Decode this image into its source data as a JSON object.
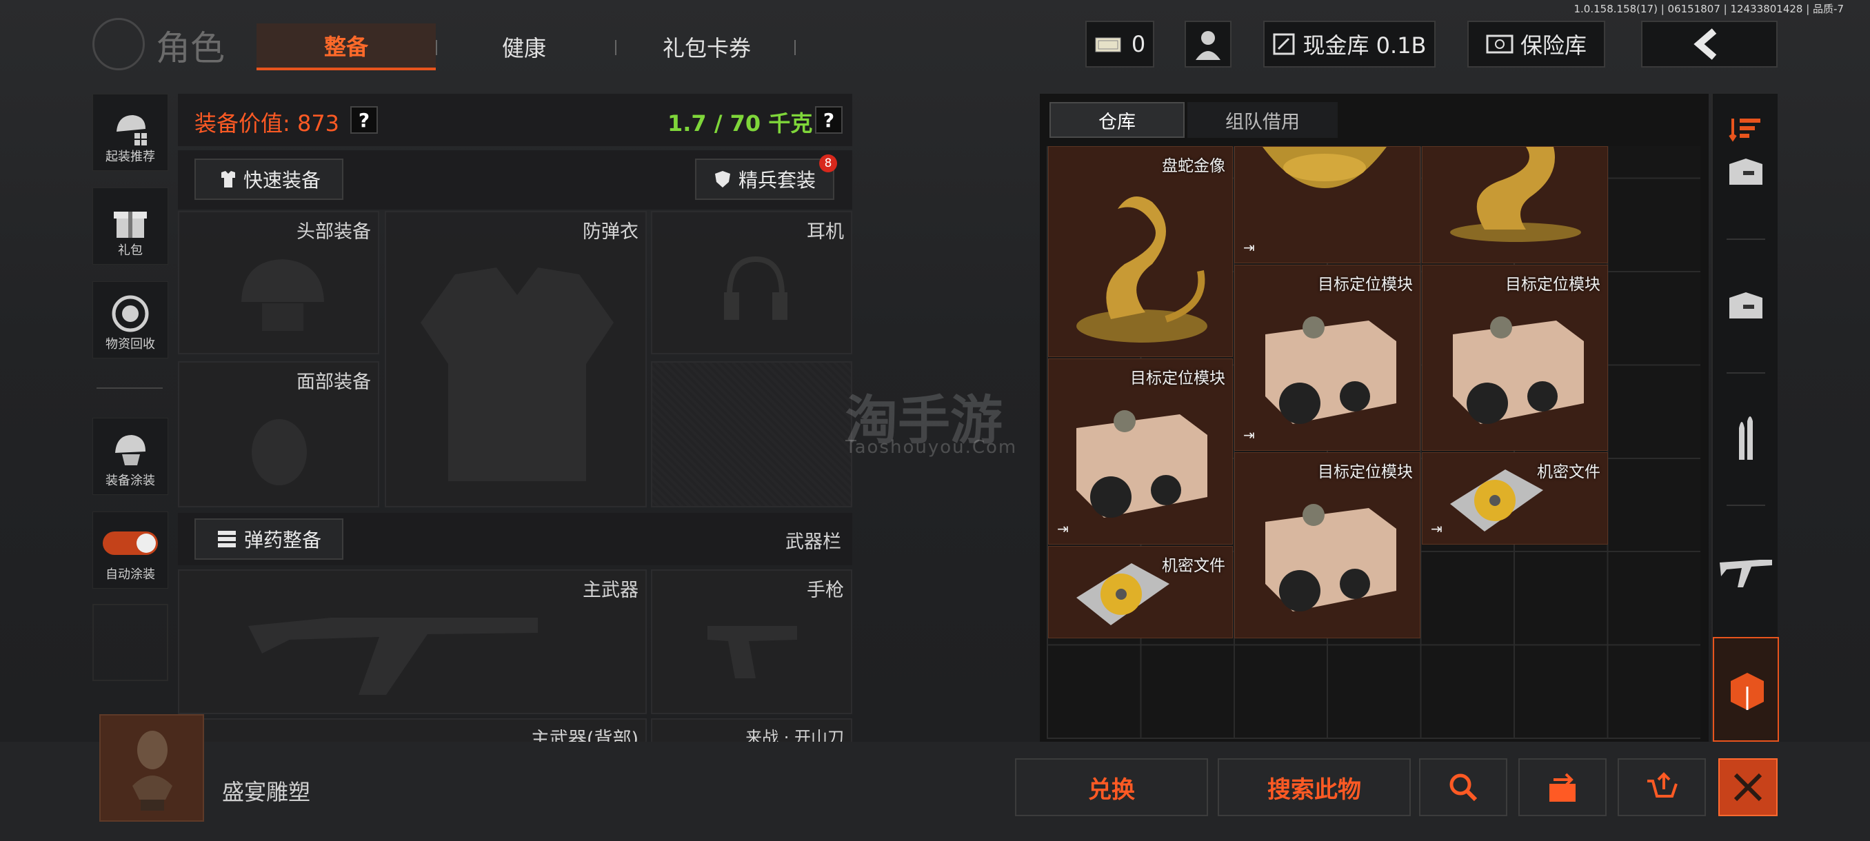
{
  "version": "1.0.158.158(17) | 06151807 | 12433801428 | 品质-7",
  "header": {
    "title": "角色",
    "tabs": [
      "整备",
      "健康",
      "礼包卡券"
    ],
    "cash_count": "0",
    "cash_vault": "现金库 0.1B",
    "safe_vault": "保险库"
  },
  "left_nav": [
    "起装推荐",
    "礼包",
    "物资回收",
    "装备涂装",
    "自动涂装"
  ],
  "equip": {
    "value_label": "装备价值: 873",
    "weight": "1.7 / 70 千克",
    "quick_equip": "快速装备",
    "elite_set": "精兵套装",
    "elite_badge": "8",
    "slots": {
      "head": "头部装备",
      "armor": "防弹衣",
      "headset": "耳机",
      "face": "面部装备"
    },
    "ammo_btn": "弹药整备",
    "weapon_bar": "武器栏",
    "primary": "主武器",
    "pistol": "手枪",
    "primary_back": "主武器(背部)",
    "melee": "来战 · 开山刀"
  },
  "storage": {
    "tabs": [
      "仓库",
      "组队借用"
    ],
    "items": {
      "snake": "盘蛇金像",
      "module": "目标定位模块",
      "file": "机密文件"
    }
  },
  "bottom": {
    "selected_name": "盛宴雕塑",
    "exchange": "兑换",
    "search": "搜索此物"
  },
  "watermark": {
    "cn": "淘手游",
    "en": "Taoshouyou.Com"
  },
  "colors": {
    "accent": "#e8541d",
    "weight_green": "#7fd63a",
    "item_bg": "#3a1f15"
  }
}
